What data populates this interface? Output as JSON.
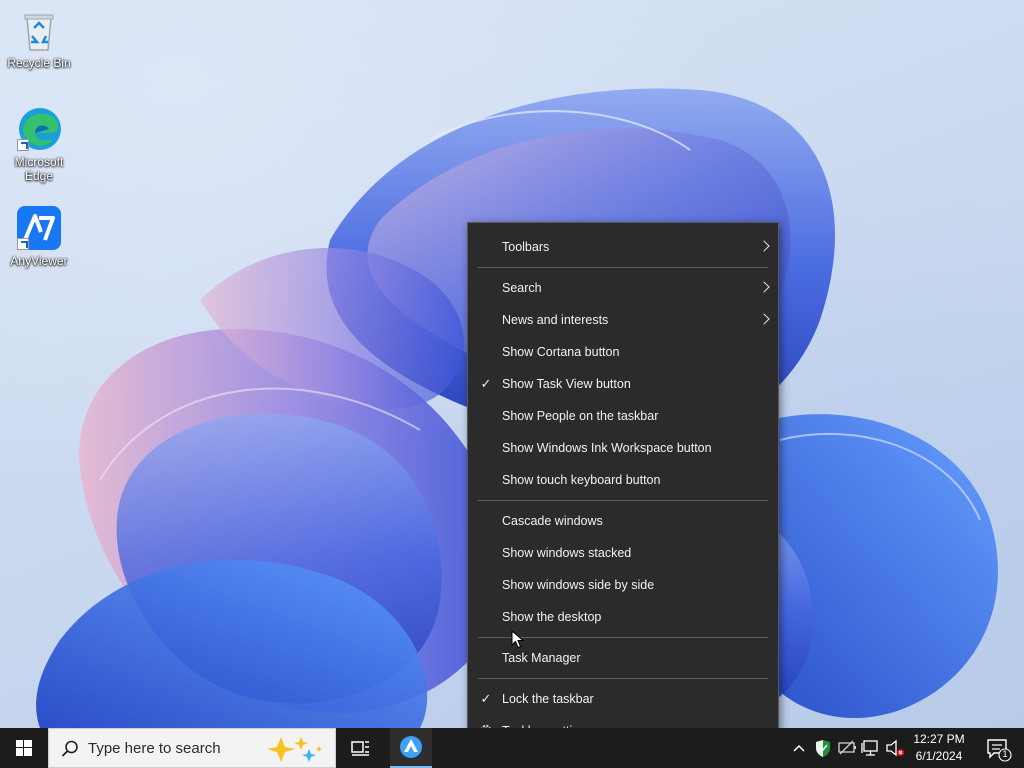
{
  "desktop": {
    "icons": [
      {
        "label": "Recycle Bin"
      },
      {
        "label": "Microsoft Edge"
      },
      {
        "label": "AnyViewer"
      }
    ]
  },
  "context_menu": {
    "items": {
      "toolbars": {
        "label": "Toolbars",
        "submenu": true
      },
      "search": {
        "label": "Search",
        "submenu": true
      },
      "news": {
        "label": "News and interests",
        "submenu": true
      },
      "cortana": {
        "label": "Show Cortana button",
        "checked": false
      },
      "task_view": {
        "label": "Show Task View button",
        "checked": true
      },
      "people": {
        "label": "Show People on the taskbar",
        "checked": false
      },
      "ink": {
        "label": "Show Windows Ink Workspace button",
        "checked": false
      },
      "touch_keyboard": {
        "label": "Show touch keyboard button",
        "checked": false
      },
      "cascade": {
        "label": "Cascade windows"
      },
      "stacked": {
        "label": "Show windows stacked"
      },
      "side_by_side": {
        "label": "Show windows side by side"
      },
      "show_desktop": {
        "label": "Show the desktop"
      },
      "task_manager": {
        "label": "Task Manager"
      },
      "lock": {
        "label": "Lock the taskbar",
        "checked": true
      },
      "settings": {
        "label": "Taskbar settings",
        "icon": "gear-icon"
      }
    },
    "check_glyph": "✓"
  },
  "taskbar": {
    "search": {
      "placeholder": "Type here to search"
    },
    "clock": {
      "time": "12:27 PM",
      "date": "6/1/2024"
    },
    "notifications": {
      "count": "1"
    },
    "icons": [
      "windows-start-icon",
      "search-icon",
      "task-view-icon",
      "anyviewer-app-icon",
      "chevron-up-icon",
      "security-shield-icon",
      "network-icon",
      "speaker-muted-icon",
      "action-center-icon"
    ]
  },
  "colors": {
    "menu_bg": "#2b2b2b",
    "taskbar_bg": "#1c1c1c",
    "accent": "#1e90ff"
  }
}
